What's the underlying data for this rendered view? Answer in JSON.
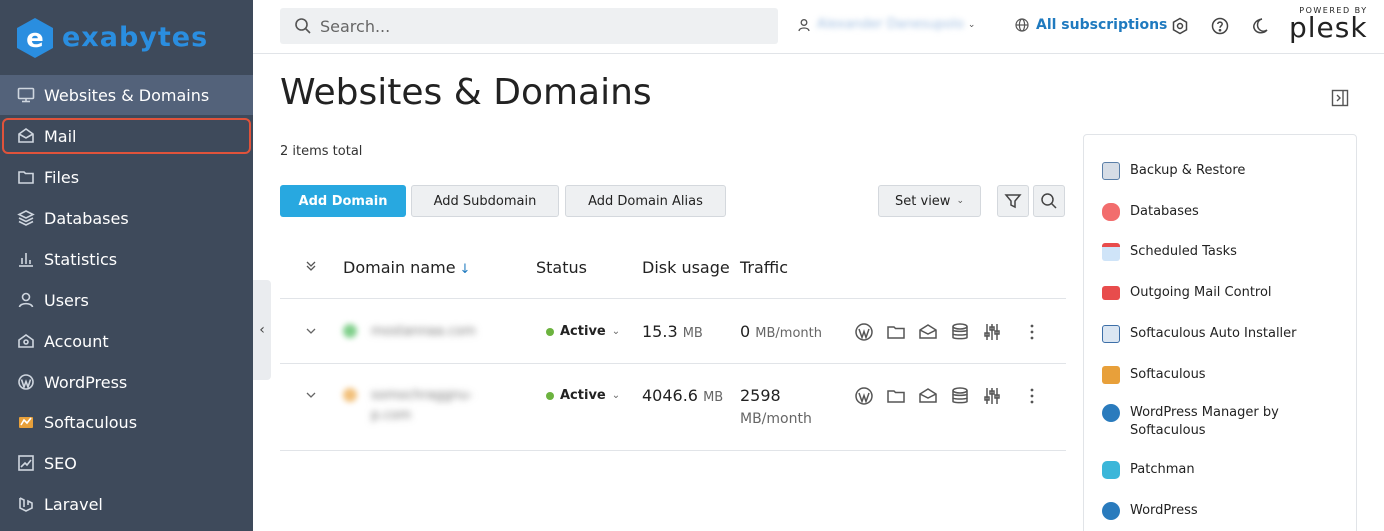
{
  "brand": {
    "logo_text": "exabytes",
    "accent": "#2a8ee0"
  },
  "sidebar": {
    "items": [
      {
        "label": "Websites & Domains",
        "icon": "monitor-icon"
      },
      {
        "label": "Mail",
        "icon": "mail-open-icon"
      },
      {
        "label": "Files",
        "icon": "folder-icon"
      },
      {
        "label": "Databases",
        "icon": "layers-icon"
      },
      {
        "label": "Statistics",
        "icon": "bar-chart-icon"
      },
      {
        "label": "Users",
        "icon": "user-icon"
      },
      {
        "label": "Account",
        "icon": "account-icon"
      },
      {
        "label": "WordPress",
        "icon": "wordpress-icon"
      },
      {
        "label": "Softaculous",
        "icon": "softaculous-icon"
      },
      {
        "label": "SEO",
        "icon": "seo-icon"
      },
      {
        "label": "Laravel",
        "icon": "laravel-icon"
      }
    ],
    "active_index": 0,
    "highlight_index": 1
  },
  "topbar": {
    "search_placeholder": "Search...",
    "user_name": "Alexander Danesupolo",
    "subscriptions_label": "All subscriptions",
    "powered_by": "POWERED BY",
    "plesk_label": "plesk"
  },
  "main": {
    "title": "Websites & Domains",
    "items_total": "2 items total",
    "buttons": {
      "add_domain": "Add Domain",
      "add_subdomain": "Add Subdomain",
      "add_domain_alias": "Add Domain Alias",
      "set_view": "Set view"
    },
    "table": {
      "headers": {
        "domain": "Domain name",
        "status": "Status",
        "disk": "Disk usage",
        "traffic": "Traffic"
      },
      "rows": [
        {
          "domain_lines": [
            "mostannaa.com"
          ],
          "status": "Active",
          "disk_value": "15.3",
          "disk_unit": "MB",
          "traffic_value": "0",
          "traffic_unit": "MB/month",
          "fav_color": "#7fcf8a"
        },
        {
          "domain_lines": [
            "somochraggnu-",
            "p.com"
          ],
          "status": "Active",
          "disk_value": "4046.6",
          "disk_unit": "MB",
          "traffic_value": "2598",
          "traffic_unit": "MB/month",
          "fav_color": "#f2c07a"
        }
      ]
    }
  },
  "right_panel": {
    "items": [
      {
        "label": "Backup & Restore",
        "icon": "backup-icon",
        "color": "#5a7fa8"
      },
      {
        "label": "Databases",
        "icon": "database-icon",
        "color": "#f26d6d"
      },
      {
        "label": "Scheduled Tasks",
        "icon": "calendar-icon",
        "color": "#6aa9e6"
      },
      {
        "label": "Outgoing Mail Control",
        "icon": "mail-icon",
        "color": "#e84c4c"
      },
      {
        "label": "Softaculous Auto Installer",
        "icon": "softaculous-auto-icon",
        "color": "#3d6fa8"
      },
      {
        "label": "Softaculous",
        "icon": "softaculous-icon",
        "color": "#e8a03a"
      },
      {
        "label": "WordPress Manager by Softaculous",
        "icon": "wordpress-icon",
        "color": "#2a7bbd"
      },
      {
        "label": "Patchman",
        "icon": "patchman-icon",
        "color": "#3bb6d9"
      },
      {
        "label": "WordPress",
        "icon": "wordpress-icon",
        "color": "#2a7bbd"
      }
    ]
  }
}
